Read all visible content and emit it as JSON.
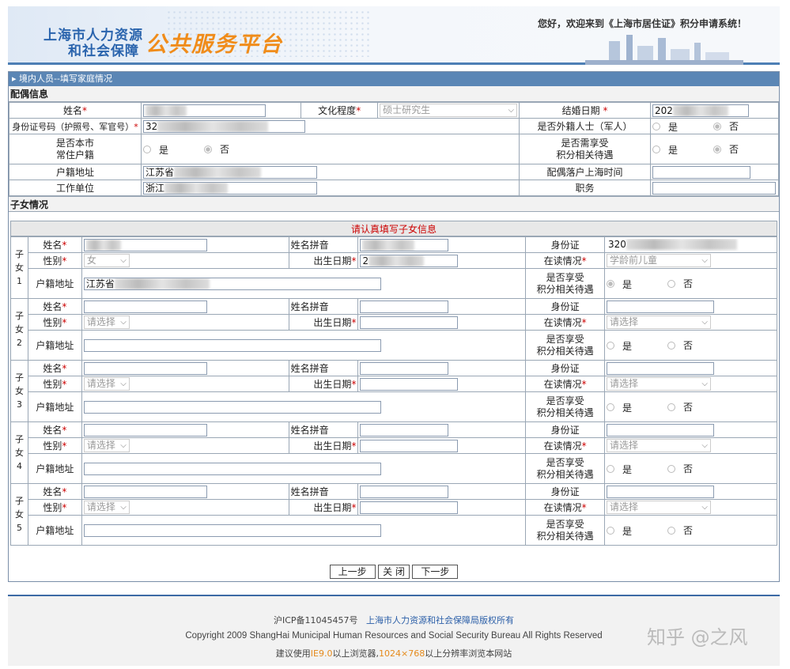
{
  "header": {
    "logo_line1": "上海市人力资源",
    "logo_line2": "和社会保障",
    "logo_platform": "公共服务平台",
    "welcome": "您好，欢迎来到《上海市居住证》积分申请系统！"
  },
  "form": {
    "breadcrumb": "境内人员--填写家庭情况",
    "spouse_section": "配偶信息",
    "spouse": {
      "name_label": "姓名",
      "edu_label": "文化程度",
      "edu_value": "硕士研究生",
      "marry_date_label": "结婚日期",
      "marry_date_value": "202",
      "id_label": "身份证号码（护照号、军官号）",
      "id_value": "32",
      "foreign_label": "是否外籍人士（军人）",
      "local_label_l1": "是否本市",
      "local_label_l2": "常住户籍",
      "benefit_label_l1": "是否需享受",
      "benefit_label_l2": "积分相关待遇",
      "yes": "是",
      "no": "否",
      "hukou_label": "户籍地址",
      "hukou_value": "江苏省",
      "settle_label": "配偶落户上海时间",
      "work_label": "工作单位",
      "work_value": "浙江",
      "job_label": "职务"
    },
    "children_section": "子女情况",
    "children_note": "请认真填写子女信息",
    "child_labels": {
      "name": "姓名",
      "pinyin": "姓名拼音",
      "id": "身份证",
      "gender": "性别",
      "birth": "出生日期",
      "study": "在读情况",
      "hukou": "户籍地址",
      "benefit_l1": "是否享受",
      "benefit_l2": "积分相关待遇",
      "yes": "是",
      "no": "否",
      "zi": "子",
      "nv": "女"
    },
    "children": [
      {
        "index": "1",
        "id_value": "320",
        "gender": "女",
        "birth_value": "2",
        "study": "学龄前儿童",
        "hukou_value": "江苏省"
      },
      {
        "index": "2",
        "id_value": "",
        "gender": "请选择",
        "birth_value": "",
        "study": "请选择",
        "hukou_value": ""
      },
      {
        "index": "3",
        "id_value": "",
        "gender": "请选择",
        "birth_value": "",
        "study": "请选择",
        "hukou_value": ""
      },
      {
        "index": "4",
        "id_value": "",
        "gender": "请选择",
        "birth_value": "",
        "study": "请选择",
        "hukou_value": ""
      },
      {
        "index": "5",
        "id_value": "",
        "gender": "请选择",
        "birth_value": "",
        "study": "请选择",
        "hukou_value": ""
      }
    ],
    "buttons": {
      "prev": "上一步",
      "close": "关 闭",
      "next": "下一步"
    }
  },
  "footer": {
    "icp": "沪ICP备11045457号",
    "copyright_owner": "上海市人力资源和社会保障局版权所有",
    "copyright_en": "Copyright 2009 ShangHai Municipal Human Resources and Social Security Bureau All Rights Reserved",
    "advice_pre": "建议使用",
    "advice_ie": "IE9.0",
    "advice_mid": "以上浏览器,",
    "advice_res": "1024×768",
    "advice_post": "以上分辨率浏览本网站"
  },
  "watermark": "知乎 @之风"
}
